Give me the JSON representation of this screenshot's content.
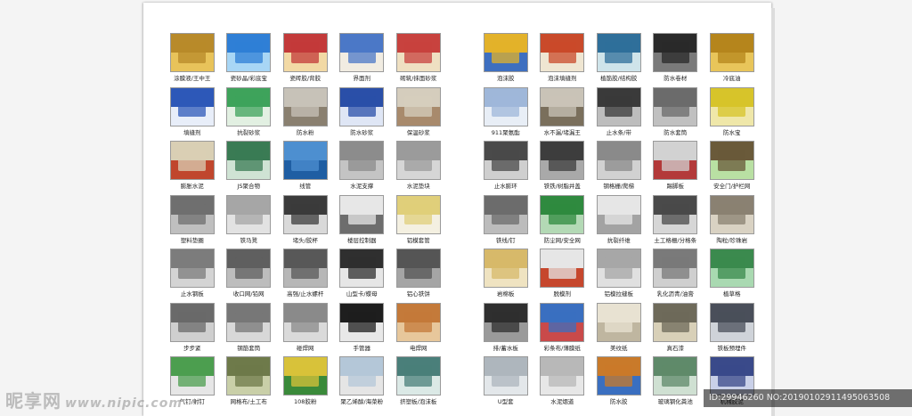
{
  "catalog": {
    "left": [
      [
        {
          "label": "涂膜液/王中王",
          "color": "#b88a2a",
          "accent": "#e8c35a",
          "icon": "product-photo"
        },
        {
          "label": "瓷砂晶/彩底宝",
          "color": "#2f7fd6",
          "accent": "#a8d6f5",
          "icon": "product-photo"
        },
        {
          "label": "瓷砖胶/背胶",
          "color": "#c33a3a",
          "accent": "#f2d9a5",
          "icon": "product-photo"
        },
        {
          "label": "界面剂",
          "color": "#4b78c7",
          "accent": "#f1ece2",
          "icon": "product-photo"
        },
        {
          "label": "砌筑/抹面砂浆",
          "color": "#c8423e",
          "accent": "#efe0c2",
          "icon": "product-photo"
        }
      ],
      [
        {
          "label": "填缝剂",
          "color": "#2d58b8",
          "accent": "#e8eef9",
          "icon": "product-photo"
        },
        {
          "label": "抗裂砂浆",
          "color": "#3ea35b",
          "accent": "#e2f0e2",
          "icon": "product-photo"
        },
        {
          "label": "防水粉",
          "color": "#c7c2b8",
          "accent": "#8a8070",
          "icon": "product-photo"
        },
        {
          "label": "防水砂浆",
          "color": "#2a4fa8",
          "accent": "#dfe6f5",
          "icon": "product-photo"
        },
        {
          "label": "保温砂浆",
          "color": "#d5cdbd",
          "accent": "#a88a6c",
          "icon": "product-photo"
        }
      ],
      [
        {
          "label": "膨胀水泥",
          "color": "#d9cfb4",
          "accent": "#c0462d",
          "icon": "product-photo"
        },
        {
          "label": "JS聚合物",
          "color": "#3a7b54",
          "accent": "#cfe3d4",
          "icon": "product-photo"
        },
        {
          "label": "线管",
          "color": "#4d8fd0",
          "accent": "#1f5ea3",
          "icon": "product-photo"
        },
        {
          "label": "水泥支撑",
          "color": "#8c8c8c",
          "accent": "#c4c4c4",
          "icon": "product-photo"
        },
        {
          "label": "水泥垫块",
          "color": "#9b9b9b",
          "accent": "#d6d6d6",
          "icon": "product-photo"
        }
      ],
      [
        {
          "label": "塑料垫圈",
          "color": "#6f6f6f",
          "accent": "#bfbfbf",
          "icon": "product-photo"
        },
        {
          "label": "铁马凳",
          "color": "#a6a6a6",
          "accent": "#e2e2e2",
          "icon": "product-photo"
        },
        {
          "label": "堵头/胶杯",
          "color": "#3b3b3b",
          "accent": "#d9d9d9",
          "icon": "product-photo"
        },
        {
          "label": "楼层控制器",
          "color": "#e7e7e7",
          "accent": "#6d6d6d",
          "icon": "product-photo"
        },
        {
          "label": "铝模套管",
          "color": "#e0cf7a",
          "accent": "#f4f0e1",
          "icon": "product-photo"
        }
      ],
      [
        {
          "label": "止水钢板",
          "color": "#7c7c7c",
          "accent": "#d4d4d4",
          "icon": "product-photo"
        },
        {
          "label": "收口网/铅网",
          "color": "#5f5f5f",
          "accent": "#bdbdbd",
          "icon": "product-photo"
        },
        {
          "label": "高强/止水螺杆",
          "color": "#585858",
          "accent": "#b7b7b7",
          "icon": "product-photo"
        },
        {
          "label": "山型卡/蝶母",
          "color": "#2f2f2f",
          "accent": "#e6e6e6",
          "icon": "product-photo"
        },
        {
          "label": "铝心铁饼",
          "color": "#555555",
          "accent": "#a5a5a5",
          "icon": "product-photo"
        }
      ],
      [
        {
          "label": "步步紧",
          "color": "#6a6a6a",
          "accent": "#cfcfcf",
          "icon": "product-photo"
        },
        {
          "label": "钢筋套筒",
          "color": "#777777",
          "accent": "#d8d8d8",
          "icon": "product-photo"
        },
        {
          "label": "碰焊网",
          "color": "#8a8a8a",
          "accent": "#dadada",
          "icon": "product-photo"
        },
        {
          "label": "手管器",
          "color": "#1e1e1e",
          "accent": "#e8e8e8",
          "icon": "product-photo"
        },
        {
          "label": "电焊网",
          "color": "#c47a3a",
          "accent": "#e7c79b",
          "icon": "product-photo"
        }
      ],
      [
        {
          "label": "气钉/射钉",
          "color": "#4c9e4f",
          "accent": "#e6e6e6",
          "icon": "product-photo"
        },
        {
          "label": "网格布/土工布",
          "color": "#6e7a4a",
          "accent": "#c9cfa8",
          "icon": "product-photo"
        },
        {
          "label": "108胶粉",
          "color": "#d8c23a",
          "accent": "#3a8a3a",
          "icon": "product-photo"
        },
        {
          "label": "聚乙烯醇/海菜粉",
          "color": "#b4c7d8",
          "accent": "#e5e5e5",
          "icon": "product-photo"
        },
        {
          "label": "挤塑板/泡沫板",
          "color": "#4a7f7a",
          "accent": "#dbe9e6",
          "icon": "product-photo"
        }
      ]
    ],
    "right": [
      [
        {
          "label": "泡沫胶",
          "color": "#e3b22a",
          "accent": "#3e6fc0",
          "icon": "product-photo"
        },
        {
          "label": "泡沫填缝剂",
          "color": "#c94a2a",
          "accent": "#efe6d2",
          "icon": "product-photo"
        },
        {
          "label": "植筋胶/结构胶",
          "color": "#2f6f9a",
          "accent": "#cfe4ea",
          "icon": "product-photo"
        },
        {
          "label": "防水卷材",
          "color": "#2a2a2a",
          "accent": "#7a7a7a",
          "icon": "product-photo"
        },
        {
          "label": "冷底油",
          "color": "#b5851c",
          "accent": "#e8c55a",
          "icon": "product-photo"
        }
      ],
      [
        {
          "label": "911聚氨酯",
          "color": "#9fb7d9",
          "accent": "#e8eef6",
          "icon": "product-photo"
        },
        {
          "label": "水不漏/堵漏王",
          "color": "#c9c3b7",
          "accent": "#7a6f5c",
          "icon": "product-photo"
        },
        {
          "label": "止水条/带",
          "color": "#3a3a3a",
          "accent": "#bdbdbd",
          "icon": "product-photo"
        },
        {
          "label": "防水套筒",
          "color": "#6b6b6b",
          "accent": "#c0c0c0",
          "icon": "product-photo"
        },
        {
          "label": "防水宝",
          "color": "#d7c42a",
          "accent": "#efe7a9",
          "icon": "product-photo"
        }
      ],
      [
        {
          "label": "止水膨环",
          "color": "#4a4a4a",
          "accent": "#cfcfcf",
          "icon": "product-photo"
        },
        {
          "label": "铁铁/树脂井盖",
          "color": "#3d3d3d",
          "accent": "#a9a9a9",
          "icon": "product-photo"
        },
        {
          "label": "钢格栅/爬梯",
          "color": "#8a8a8a",
          "accent": "#d1d1d1",
          "icon": "product-photo"
        },
        {
          "label": "踢脚板",
          "color": "#d2d2d2",
          "accent": "#b33a3a",
          "icon": "product-photo"
        },
        {
          "label": "安全门/护栏网",
          "color": "#6a5a3a",
          "accent": "#b9e0a3",
          "icon": "product-photo"
        }
      ],
      [
        {
          "label": "铁线/钉",
          "color": "#6c6c6c",
          "accent": "#bcbcbc",
          "icon": "product-photo"
        },
        {
          "label": "防尘网/安全网",
          "color": "#2f8a3f",
          "accent": "#b3d9b5",
          "icon": "product-photo"
        },
        {
          "label": "抗裂纤维",
          "color": "#e6e6e6",
          "accent": "#a3a3a3",
          "icon": "product-photo"
        },
        {
          "label": "土工格栅/分格条",
          "color": "#4a4a4a",
          "accent": "#d6d6d6",
          "icon": "product-photo"
        },
        {
          "label": "陶粒/珍珠岩",
          "color": "#8a8172",
          "accent": "#d9d2c3",
          "icon": "product-photo"
        }
      ],
      [
        {
          "label": "岩棉板",
          "color": "#d7b96a",
          "accent": "#efe3c1",
          "icon": "product-photo"
        },
        {
          "label": "脱模剂",
          "color": "#e6e6e6",
          "accent": "#c6472d",
          "icon": "product-photo"
        },
        {
          "label": "铝模拉缝板",
          "color": "#a7a7a7",
          "accent": "#e0e0e0",
          "icon": "product-photo"
        },
        {
          "label": "乳化沥青/油膏",
          "color": "#7a7a7a",
          "accent": "#cfcfcf",
          "icon": "product-photo"
        },
        {
          "label": "植草格",
          "color": "#3b8a4e",
          "accent": "#a9d9b1",
          "icon": "product-photo"
        }
      ],
      [
        {
          "label": "排/蓄水板",
          "color": "#2f2f2f",
          "accent": "#9a9a9a",
          "icon": "product-photo"
        },
        {
          "label": "彩条布/薄膜纸",
          "color": "#3a6fc0",
          "accent": "#c94a4a",
          "icon": "product-photo"
        },
        {
          "label": "美纹纸",
          "color": "#e8e2d2",
          "accent": "#bfb6a0",
          "icon": "product-photo"
        },
        {
          "label": "真石漆",
          "color": "#6e6a5a",
          "accent": "#d8d0b8",
          "icon": "product-photo"
        },
        {
          "label": "铁板预埋件",
          "color": "#4a4f5a",
          "accent": "#cfd3d9",
          "icon": "product-photo"
        }
      ],
      [
        {
          "label": "U型套",
          "color": "#aeb6bd",
          "accent": "#e3e7ea",
          "icon": "product-photo"
        },
        {
          "label": "水泥烟道",
          "color": "#b8b8b8",
          "accent": "#e7e7e7",
          "icon": "product-photo"
        },
        {
          "label": "防水胶",
          "color": "#c97a2a",
          "accent": "#3a6fc0",
          "icon": "product-photo"
        },
        {
          "label": "玻璃钢化粪池",
          "color": "#5f8a6a",
          "accent": "#cfe0d2",
          "icon": "product-photo"
        },
        {
          "label": "机械胶泥",
          "color": "#3a4a8a",
          "accent": "#c9d0e8",
          "icon": "product-photo"
        }
      ]
    ]
  },
  "watermark": {
    "text": "昵享网",
    "url": "www.nipic.com"
  },
  "image_id_text": "ID:29946260 NO:20190102911495063508"
}
